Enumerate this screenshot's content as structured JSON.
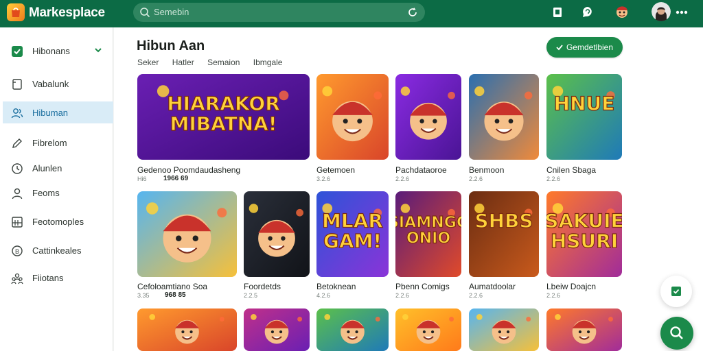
{
  "header": {
    "app_title": "Markesplace",
    "search_placeholder": "Semebin"
  },
  "sidebar": {
    "items": [
      {
        "label": "Hibonans",
        "icon": "checkbox-icon"
      },
      {
        "label": "Vabalunk",
        "icon": "document-icon"
      },
      {
        "label": "Hibuman",
        "icon": "users-icon"
      },
      {
        "label": "Fibrelom",
        "icon": "edit-icon"
      },
      {
        "label": "Alunlen",
        "icon": "clock-icon"
      },
      {
        "label": "Feoms",
        "icon": "person-icon"
      },
      {
        "label": "Feotomoples",
        "icon": "grid-icon"
      },
      {
        "label": "Cattinkeales",
        "icon": "coin-icon"
      },
      {
        "label": "Fiiotans",
        "icon": "group-icon"
      }
    ]
  },
  "main": {
    "title": "Hibun Aan",
    "filters": [
      "Seker",
      "Hatler",
      "Semaion",
      "Ibmgale"
    ],
    "cta_label": "Gemdetlbien"
  },
  "cards": [
    {
      "title": "Gedenoo Poomdaudasheng",
      "sub1": "Hi6",
      "sub2": "1966 69",
      "art": "HIARAKOR MIBATNA!",
      "theme": "purple"
    },
    {
      "title": "Getemoen",
      "sub1": "3.2.6",
      "sub2": "",
      "art": "",
      "theme": "orange"
    },
    {
      "title": "Pachdataoroe",
      "sub1": "2.2.6",
      "sub2": "",
      "art": "",
      "theme": "violet"
    },
    {
      "title": "Benmoon",
      "sub1": "2.2.6",
      "sub2": "",
      "art": "",
      "theme": "city"
    },
    {
      "title": "Cnilen Sbaga",
      "sub1": "2.2.6",
      "sub2": "",
      "art": "HNUE",
      "theme": "green"
    },
    {
      "title": "Cefoloamtiano Soa",
      "sub1": "3.35",
      "sub2": "968 85",
      "art": "",
      "theme": "sky"
    },
    {
      "title": "Foordetds",
      "sub1": "2.2.5",
      "sub2": "",
      "art": "",
      "theme": "dark"
    },
    {
      "title": "Betoknean",
      "sub1": "4.2.6",
      "sub2": "",
      "art": "MLAR GAM!",
      "theme": "blue"
    },
    {
      "title": "Pbenn Comigs",
      "sub1": "2.2.6",
      "sub2": "",
      "art": "SIAMNGG ONIO",
      "theme": "plum"
    },
    {
      "title": "Aumatdoolar",
      "sub1": "2.2.6",
      "sub2": "",
      "art": "SHBS",
      "theme": "brown"
    },
    {
      "title": "Lbeiw Doajcn",
      "sub1": "2.2.6",
      "sub2": "",
      "art": "SAKUIE HSURI",
      "theme": "sunset"
    },
    {
      "title": "",
      "sub1": "",
      "sub2": "",
      "art": "",
      "theme": "orange"
    },
    {
      "title": "",
      "sub1": "",
      "sub2": "",
      "art": "",
      "theme": "magenta"
    },
    {
      "title": "",
      "sub1": "",
      "sub2": "",
      "art": "",
      "theme": "green"
    },
    {
      "title": "",
      "sub1": "",
      "sub2": "",
      "art": "",
      "theme": "yellow"
    },
    {
      "title": "",
      "sub1": "",
      "sub2": "",
      "art": "",
      "theme": "sky"
    },
    {
      "title": "",
      "sub1": "",
      "sub2": "",
      "art": "",
      "theme": "sunset"
    }
  ],
  "colors": {
    "brand": "#0c6b45",
    "accent": "#1b8a4a",
    "active": "#d9ecf7"
  }
}
